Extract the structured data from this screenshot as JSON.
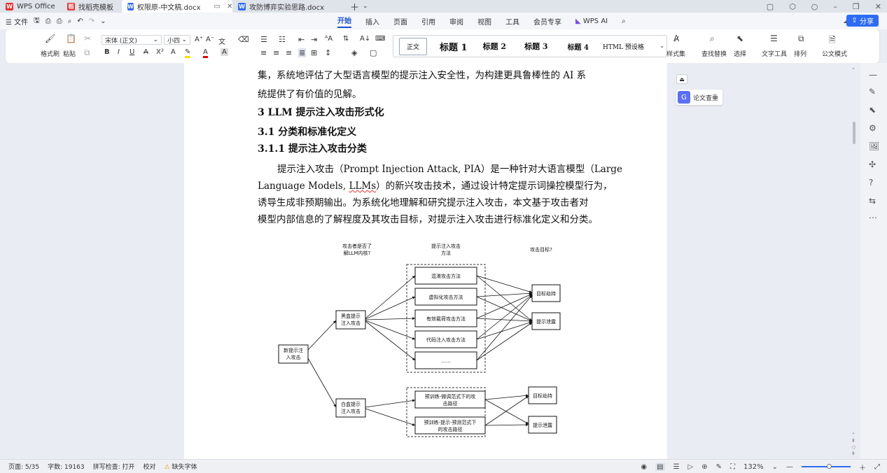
{
  "tabs": [
    {
      "label": "WPS Office",
      "color": "#e5322d",
      "glyph": "W"
    },
    {
      "label": "找稻壳模板",
      "color": "#e5322d",
      "glyph": "稻"
    },
    {
      "label": "权限原-中文稿.docx",
      "color": "#2e6cf6",
      "glyph": "W"
    },
    {
      "label": "攻防博弈实验思路.docx",
      "color": "#2e6cf6",
      "glyph": "W"
    }
  ],
  "menu": {
    "file": "文件",
    "items": [
      "开始",
      "插入",
      "页面",
      "引用",
      "审阅",
      "视图",
      "工具",
      "会员专享"
    ],
    "wps_ai": "WPS AI",
    "share": "分享"
  },
  "ribbon": {
    "format_painter": "格式刷",
    "paste": "粘贴",
    "font_name": "宋体 (正文)",
    "font_size": "小四",
    "styles": [
      "正文",
      "标题 1",
      "标题 2",
      "标题 3",
      "标题 4",
      "HTML 预设格"
    ],
    "style_set": "样式集",
    "find_replace": "查找替换",
    "select": "选择",
    "text_tools": "文字工具",
    "arrange": "排列",
    "official_mode": "公文模式"
  },
  "doc": {
    "line1": "集，系统地评估了大型语言模型的提示注入安全性，为构建更具鲁棒性的 AI 系",
    "line2": "统提供了有价值的见解。",
    "h1": "3 LLM 提示注入攻击形式化",
    "h2": "3.1  分类和标准化定义",
    "h3": "3.1.1  提示注入攻击分类",
    "para1": "提示注入攻击（Prompt Injection Attack, PIA）是一种针对大语言模型（Large",
    "para2a": "Language Models, ",
    "para2b": "LLMs",
    "para2c": "）的新兴攻击技术，通过设计特定提示词操控模型行为，",
    "para3": "诱导生成非预期输出。为系统化地理解和研究提示注入攻击，本文基于攻击者对",
    "para4": "模型内部信息的了解程度及其攻击目标，对提示注入攻击进行标准化定义和分类。"
  },
  "diagram": {
    "col1_line1": "攻击者是否了",
    "col1_line2": "解LLM内核?",
    "col2_line1": "提示注入攻击",
    "col2_line2": "方法",
    "col3": "攻击目标?",
    "root_line1": "新提示注",
    "root_line2": "入攻击",
    "black_line1": "黑盒提示",
    "black_line2": "注入攻击",
    "white_line1": "白盒提示",
    "white_line2": "注入攻击",
    "m1": "混淆攻击方法",
    "m2": "虚拟化攻击方法",
    "m3": "有效载荷攻击方法",
    "m4": "代码注入攻击方法",
    "m5": "……",
    "w1_line1": "预训练-微调范式下的攻",
    "w1_line2": "击路径",
    "w2_line1": "预训练-提示-预测范式下",
    "w2_line2": "的攻击路径",
    "goal_hijack": "目标劫持",
    "goal_leak": "提示泄露"
  },
  "right_panel": {
    "paper_check": "论文查重"
  },
  "status": {
    "page": "页面: 5/35",
    "words": "字数: 19163",
    "spell": "拼写检查: 打开",
    "proof": "校对",
    "missing_font": "缺失字体",
    "zoom": "132%"
  }
}
